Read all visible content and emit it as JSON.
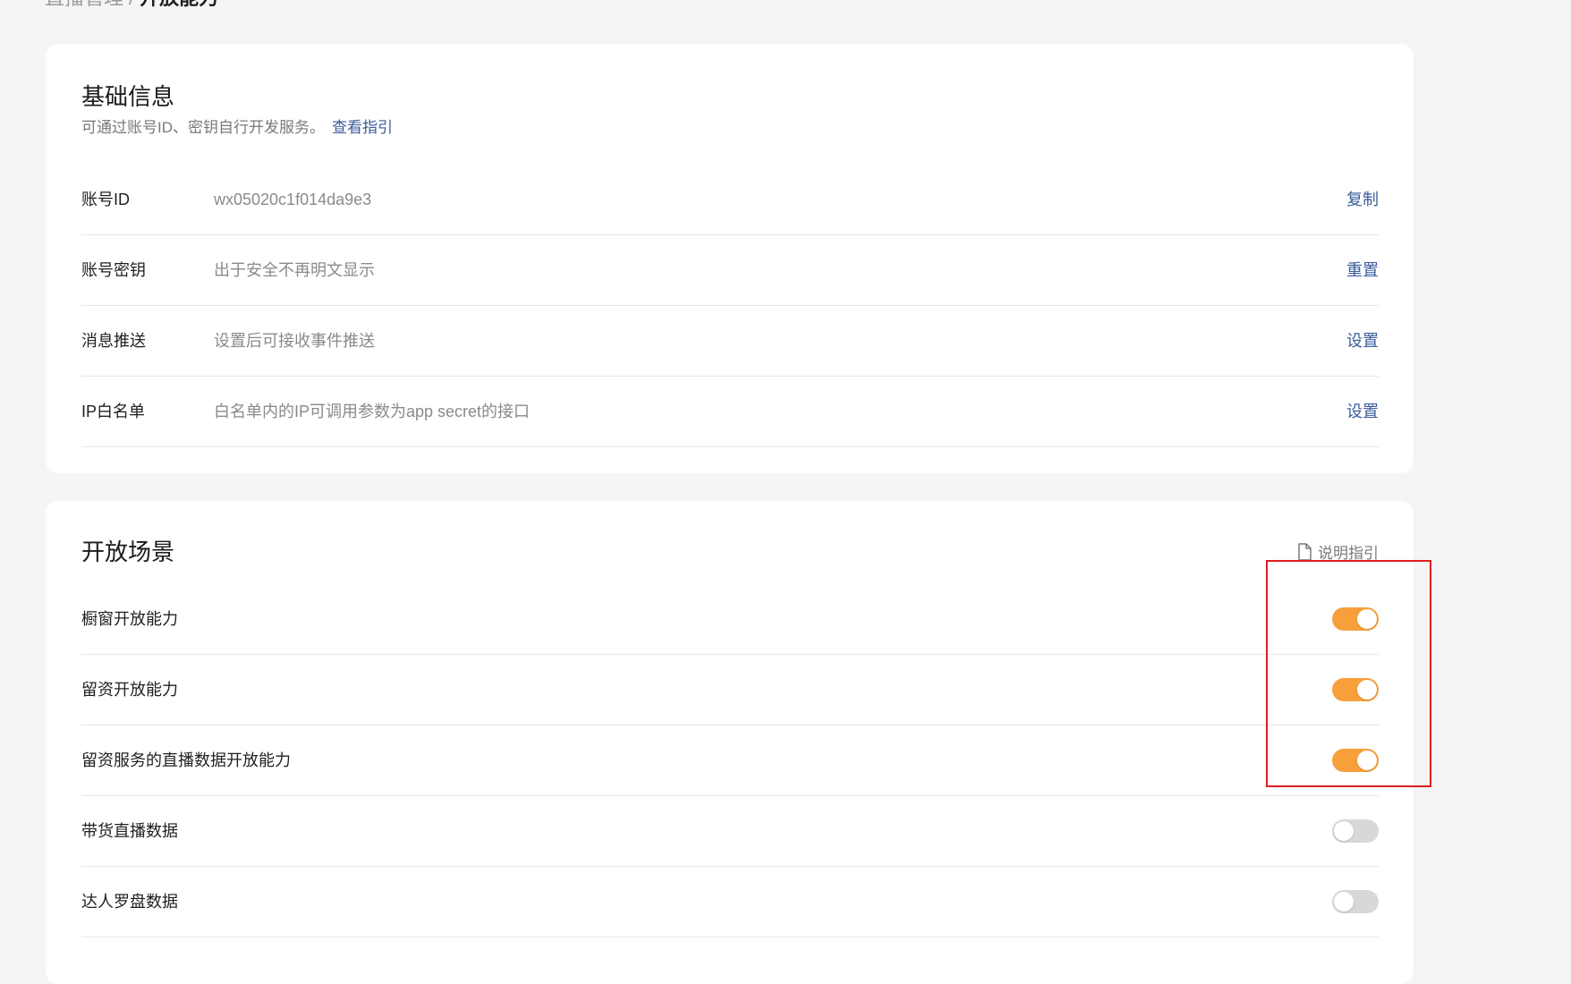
{
  "breadcrumb": {
    "parent": "直播管理",
    "separator": "/",
    "current": "开放能力"
  },
  "basic": {
    "title": "基础信息",
    "description": "可通过账号ID、密钥自行开发服务。",
    "guide_link": "查看指引",
    "rows": [
      {
        "label": "账号ID",
        "value": "wx05020c1f014da9e3",
        "action": "复制"
      },
      {
        "label": "账号密钥",
        "value": "出于安全不再明文显示",
        "action": "重置"
      },
      {
        "label": "消息推送",
        "value": "设置后可接收事件推送",
        "action": "设置"
      },
      {
        "label": "IP白名单",
        "value": "白名单内的IP可调用参数为app secret的接口",
        "action": "设置"
      }
    ]
  },
  "scene": {
    "title": "开放场景",
    "guide_link": "说明指引",
    "guide_icon": "document-icon",
    "rows": [
      {
        "label": "橱窗开放能力",
        "enabled": true
      },
      {
        "label": "留资开放能力",
        "enabled": true
      },
      {
        "label": "留资服务的直播数据开放能力",
        "enabled": true
      },
      {
        "label": "带货直播数据",
        "enabled": false
      },
      {
        "label": "达人罗盘数据",
        "enabled": false
      }
    ]
  },
  "colors": {
    "toggle_on": "#f7a03b",
    "toggle_off": "#d8d8d8",
    "link": "#3a5b9a",
    "highlight": "#e11d1d"
  }
}
